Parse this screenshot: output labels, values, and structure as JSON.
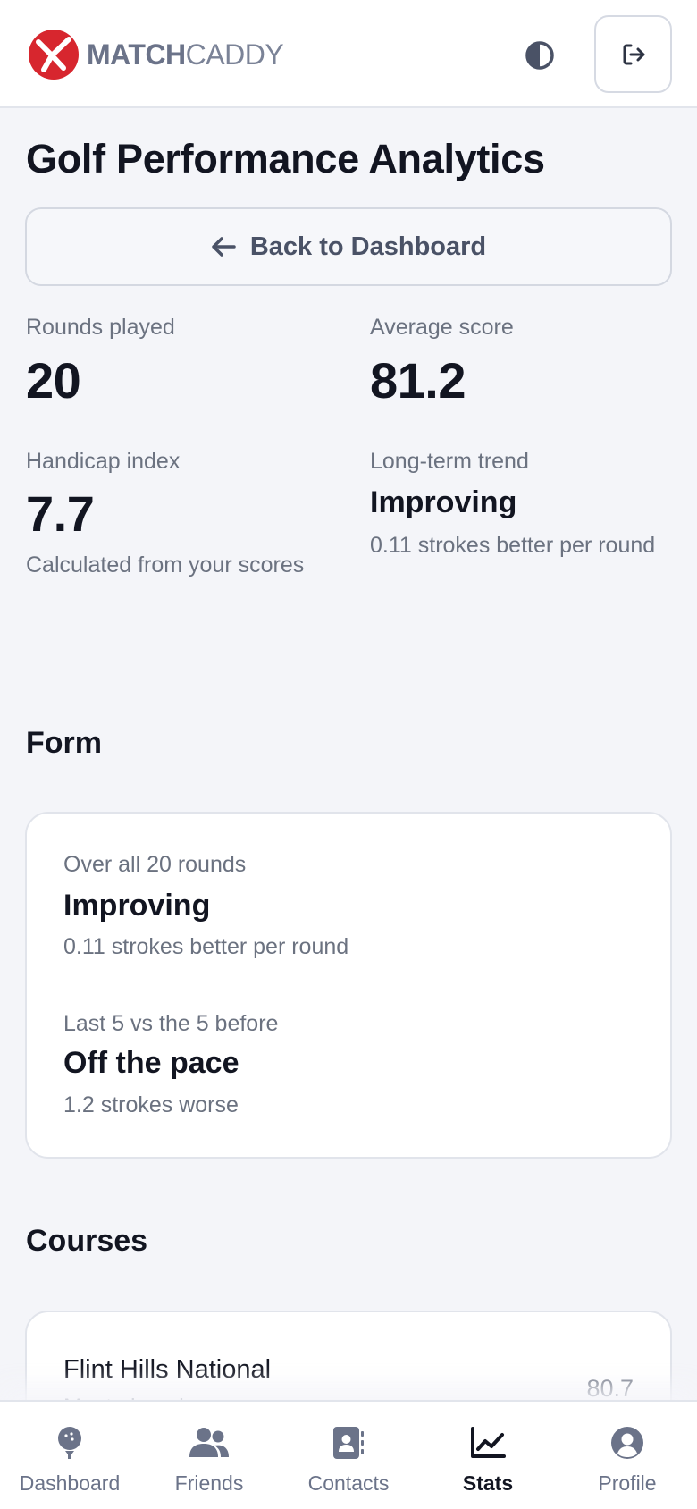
{
  "app": {
    "brand_bold": "MATCH",
    "brand_light": "CADDY",
    "brand_color": "#d7262e"
  },
  "header": {
    "theme_toggle_icon": "contrast-icon",
    "logout_icon": "logout-icon"
  },
  "page": {
    "title": "Golf Performance Analytics",
    "back_label": "Back to Dashboard"
  },
  "stats": {
    "rounds_label": "Rounds played",
    "rounds_value": "20",
    "average_label": "Average score",
    "average_value": "81.2",
    "handicap_label": "Handicap index",
    "handicap_value": "7.7",
    "handicap_note": "Calculated from your scores",
    "trend_label": "Long-term trend",
    "trend_value": "Improving",
    "trend_note": "0.11 strokes better per round"
  },
  "form": {
    "section_title": "Form",
    "overall_label": "Over all 20 rounds",
    "overall_value": "Improving",
    "overall_note": "0.11 strokes better per round",
    "recent_label": "Last 5 vs the 5 before",
    "recent_value": "Off the pace",
    "recent_note": "1.2 strokes worse"
  },
  "courses": {
    "section_title": "Courses",
    "items": [
      {
        "name": "Flint Hills National",
        "meta": "Most played",
        "average": "80.7"
      }
    ]
  },
  "nav": {
    "items": [
      {
        "label": "Dashboard",
        "icon": "golf-ball-tee-icon"
      },
      {
        "label": "Friends",
        "icon": "users-icon"
      },
      {
        "label": "Contacts",
        "icon": "address-book-icon"
      },
      {
        "label": "Stats",
        "icon": "chart-line-icon"
      },
      {
        "label": "Profile",
        "icon": "user-circle-icon"
      }
    ],
    "active": "Stats"
  }
}
